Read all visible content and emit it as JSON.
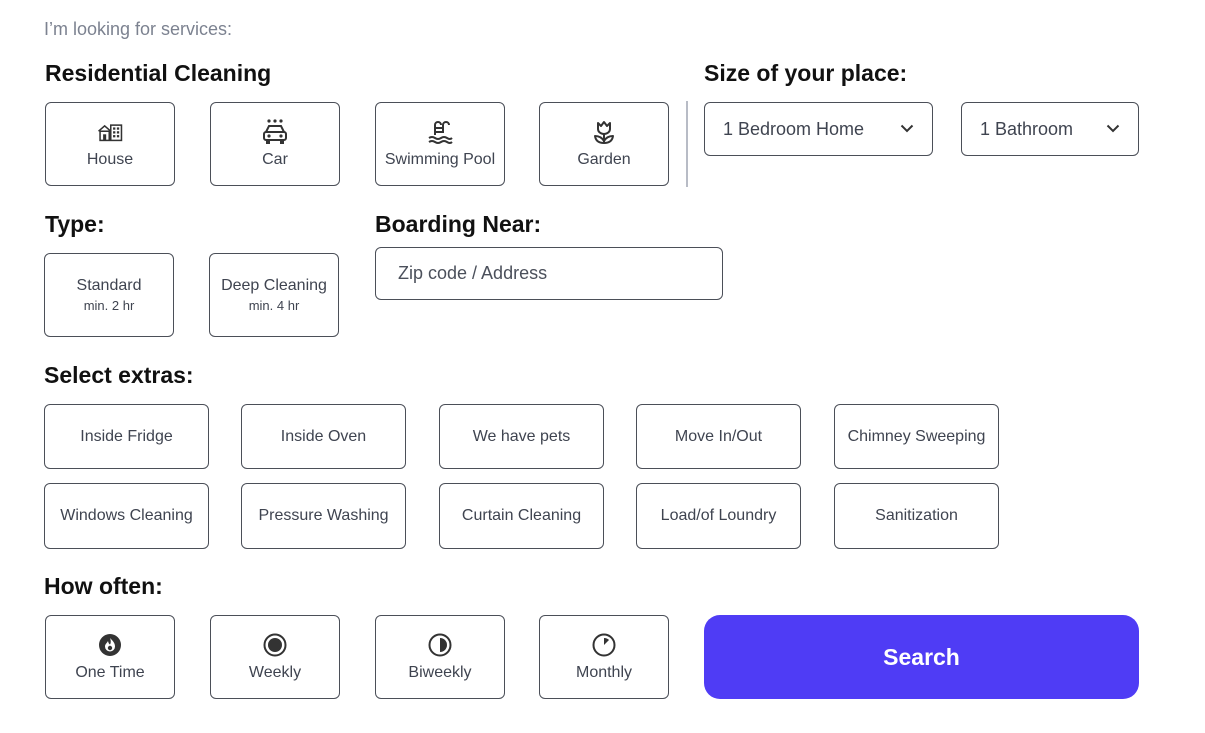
{
  "header": {
    "eyebrow": "I’m looking for services:"
  },
  "service": {
    "title": "Residential Cleaning",
    "options": [
      {
        "label": "House",
        "icon": "building-icon"
      },
      {
        "label": "Car",
        "icon": "car-wash-icon"
      },
      {
        "label": "Swimming Pool",
        "icon": "pool-ladder-icon"
      },
      {
        "label": "Garden",
        "icon": "flower-icon"
      }
    ]
  },
  "size": {
    "title": "Size of your place:",
    "bedrooms": "1 Bedroom Home",
    "bathrooms": "1 Bathroom"
  },
  "type": {
    "title": "Type:",
    "options": [
      {
        "label": "Standard",
        "sub": "min. 2 hr"
      },
      {
        "label": "Deep Cleaning",
        "sub": "min. 4 hr"
      }
    ]
  },
  "boarding": {
    "title": "Boarding Near:",
    "placeholder": "Zip code / Address"
  },
  "extras": {
    "title": "Select extras:",
    "items": [
      "Inside Fridge",
      "Inside Oven",
      "We have pets",
      "Move In/Out",
      "Chimney Sweeping",
      "Windows Cleaning",
      "Pressure Washing",
      "Curtain Cleaning",
      "Load/of Loundry",
      "Sanitization"
    ]
  },
  "frequency": {
    "title": "How often:",
    "options": [
      {
        "label": "One Time",
        "icon": "flame-circle-icon"
      },
      {
        "label": "Weekly",
        "icon": "full-circle-icon"
      },
      {
        "label": "Biweekly",
        "icon": "half-circle-icon"
      },
      {
        "label": "Monthly",
        "icon": "quarter-circle-icon"
      }
    ]
  },
  "search_button": "Search"
}
